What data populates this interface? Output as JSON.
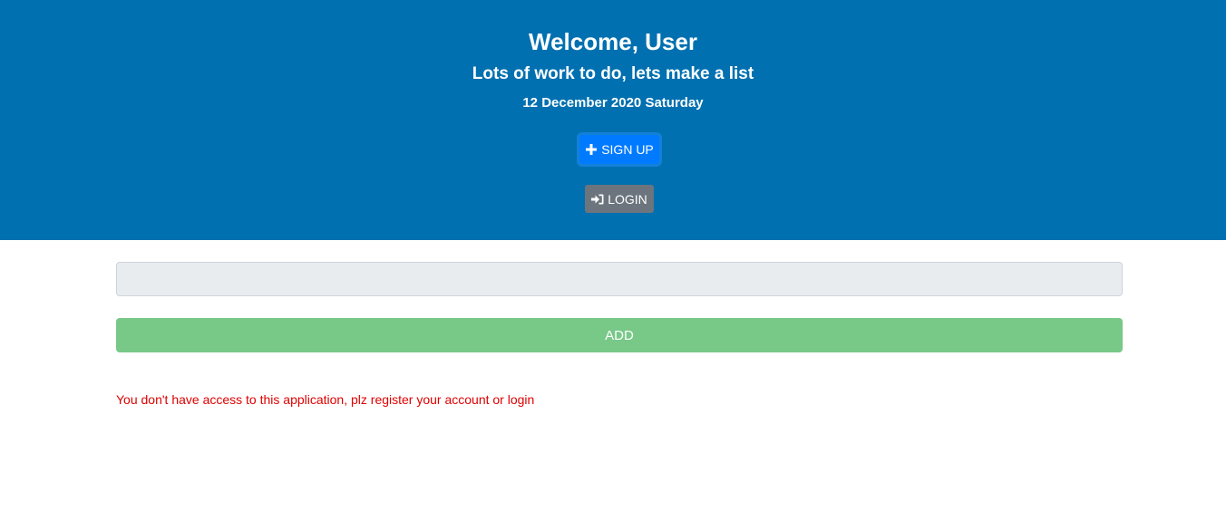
{
  "header": {
    "welcome": "Welcome, User",
    "subtitle": "Lots of work to do, lets make a list",
    "date": "12 December 2020 Saturday",
    "background_color": "#0070b0"
  },
  "auth": {
    "signup_label": "SIGN UP",
    "signup_icon": "plus-icon",
    "signup_color": "#007bff",
    "login_label": "LOGIN",
    "login_icon": "sign-in-icon",
    "login_color": "#6c757d"
  },
  "todo": {
    "input_value": "",
    "input_placeholder": "",
    "add_label": "ADD",
    "add_color": "#78c888"
  },
  "message": {
    "access_denied": "You don't have access to this application, plz register your account or login",
    "color": "#e00000"
  }
}
